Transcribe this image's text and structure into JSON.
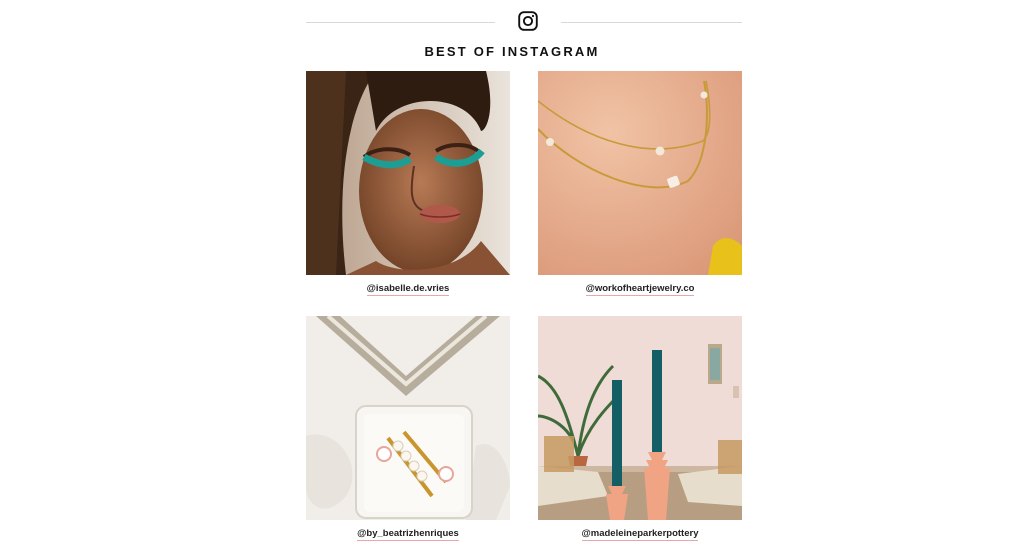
{
  "header": {
    "icon": "instagram-icon",
    "title": "BEST OF INSTAGRAM"
  },
  "posts": [
    {
      "handle": "@isabelle.de.vries"
    },
    {
      "handle": "@workofheartjewelry.co"
    },
    {
      "handle": "@by_beatrizhenriques"
    },
    {
      "handle": "@madeleineparkerpottery"
    }
  ],
  "colors": {
    "divider": "#d9d9d9",
    "handle_underline": "#e7a8a8",
    "text": "#111111"
  }
}
